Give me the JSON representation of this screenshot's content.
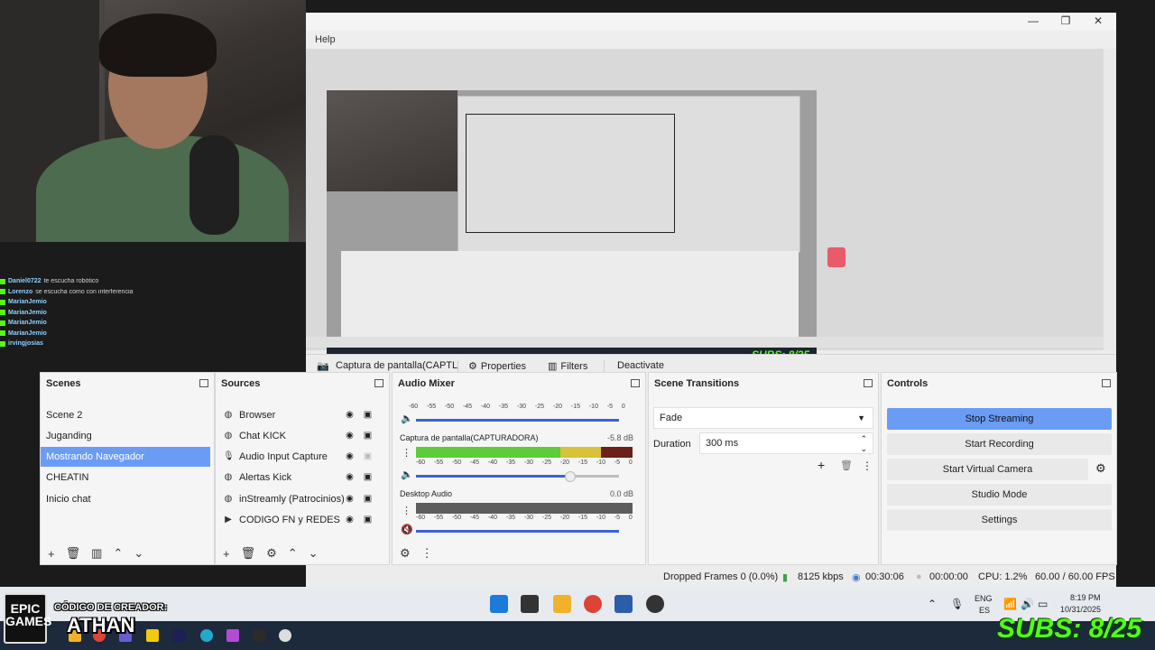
{
  "stream_overlay": {
    "chat": [
      {
        "user": "Daniel0722",
        "msg": "te escucha robótico"
      },
      {
        "user": "Lorenzo",
        "msg": "se escucha como con interferencia"
      },
      {
        "user": "MarianJemio",
        "msg": ""
      },
      {
        "user": "MarianJemio",
        "msg": ""
      },
      {
        "user": "MarianJemio",
        "msg": ""
      },
      {
        "user": "MarianJemio",
        "msg": ""
      },
      {
        "user": "irvingjosias",
        "msg": ""
      }
    ],
    "epic_logo": "EPIC GAMES",
    "creator_label": "CÓDIGO DE CREADOR:",
    "creator_name": "ATHAN",
    "subs": "SUBS: 8/25",
    "subs_mini": "SUBS: 8/25"
  },
  "obs": {
    "menu_help": "Help",
    "window_controls": {
      "minimize": "—",
      "maximize": "❐",
      "close": "✕"
    },
    "context_bar": {
      "source_name": "Captura de pantalla(CAPTL",
      "properties": "Properties",
      "filters": "Filters",
      "deactivate": "Deactivate"
    },
    "scenes": {
      "title": "Scenes",
      "items": [
        "Scene 2",
        "Juganding",
        "Mostrando Navegador",
        "CHEATIN",
        "Inicio chat"
      ],
      "selected": "Mostrando Navegador"
    },
    "sources": {
      "title": "Sources",
      "items": [
        {
          "name": "Browser",
          "icon": "globe-icon"
        },
        {
          "name": "Chat KICK",
          "icon": "globe-icon"
        },
        {
          "name": "Audio Input Capture",
          "icon": "microphone-icon"
        },
        {
          "name": "Alertas Kick",
          "icon": "globe-icon"
        },
        {
          "name": "inStreamly (Patrocinios)",
          "icon": "globe-icon"
        },
        {
          "name": "CODIGO FN y REDES",
          "icon": "play-icon"
        }
      ]
    },
    "audio_mixer": {
      "title": "Audio Mixer",
      "ticks": [
        "-60",
        "-55",
        "-50",
        "-45",
        "-40",
        "-35",
        "-30",
        "-25",
        "-20",
        "-15",
        "-10",
        "-5",
        "0"
      ],
      "channels": [
        {
          "name": "Captura de pantalla(CAPTURADORA)",
          "db": "-5.8 dB"
        },
        {
          "name": "Desktop Audio",
          "db": "0.0 dB"
        }
      ]
    },
    "scene_transitions": {
      "title": "Scene Transitions",
      "transition": "Fade",
      "duration_label": "Duration",
      "duration_value": "300 ms"
    },
    "controls": {
      "title": "Controls",
      "stop_streaming": "Stop Streaming",
      "start_recording": "Start Recording",
      "start_virtual_camera": "Start Virtual Camera",
      "studio_mode": "Studio Mode",
      "settings": "Settings"
    },
    "status": {
      "dropped_frames": "Dropped Frames 0 (0.0%)",
      "kbps": "8125 kbps",
      "stream_time": "00:30:06",
      "rec_time": "00:00:00",
      "cpu": "CPU: 1.2%",
      "fps": "60.00 / 60.00 FPS"
    },
    "colors": {
      "accent": "#6a9cf5",
      "meter_green": "#5ecb3a",
      "slider_blue": "#3b63d4"
    }
  },
  "taskbar": {
    "lang_top": "ENG",
    "lang_bottom": "ES",
    "time": "8:19 PM",
    "date": "10/31/2025"
  }
}
